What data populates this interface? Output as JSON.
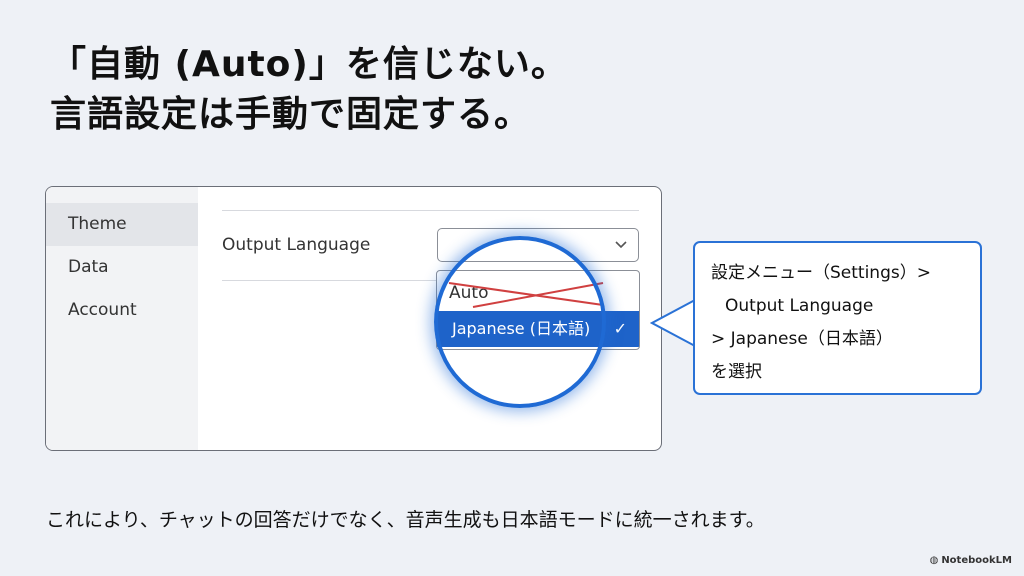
{
  "slide": {
    "title_line1": "「自動 (Auto)」を信じない。",
    "title_line2": "言語設定は手動で固定する。",
    "footer": "これにより、チャットの回答だけでなく、音声生成も日本語モードに統一されます。",
    "brand": "NotebookLM"
  },
  "settings": {
    "sidebar": [
      {
        "label": "Theme",
        "active": true
      },
      {
        "label": "Data",
        "active": false
      },
      {
        "label": "Account",
        "active": false
      }
    ],
    "output_label": "Output Language",
    "options": {
      "auto": "Auto",
      "selected": "Japanese (日本語)"
    }
  },
  "callout": {
    "line1": "設定メニュー（Settings）>",
    "line2": "Output Language",
    "line3": "> Japanese（日本語）",
    "line4": "を選択"
  },
  "icons": {
    "chevron": "chevron-down-icon",
    "check": "check-icon",
    "brand": "notebooklm-logo-icon"
  },
  "colors": {
    "accent": "#1e63c9",
    "strike": "#d04040",
    "background": "#eef1f6"
  }
}
